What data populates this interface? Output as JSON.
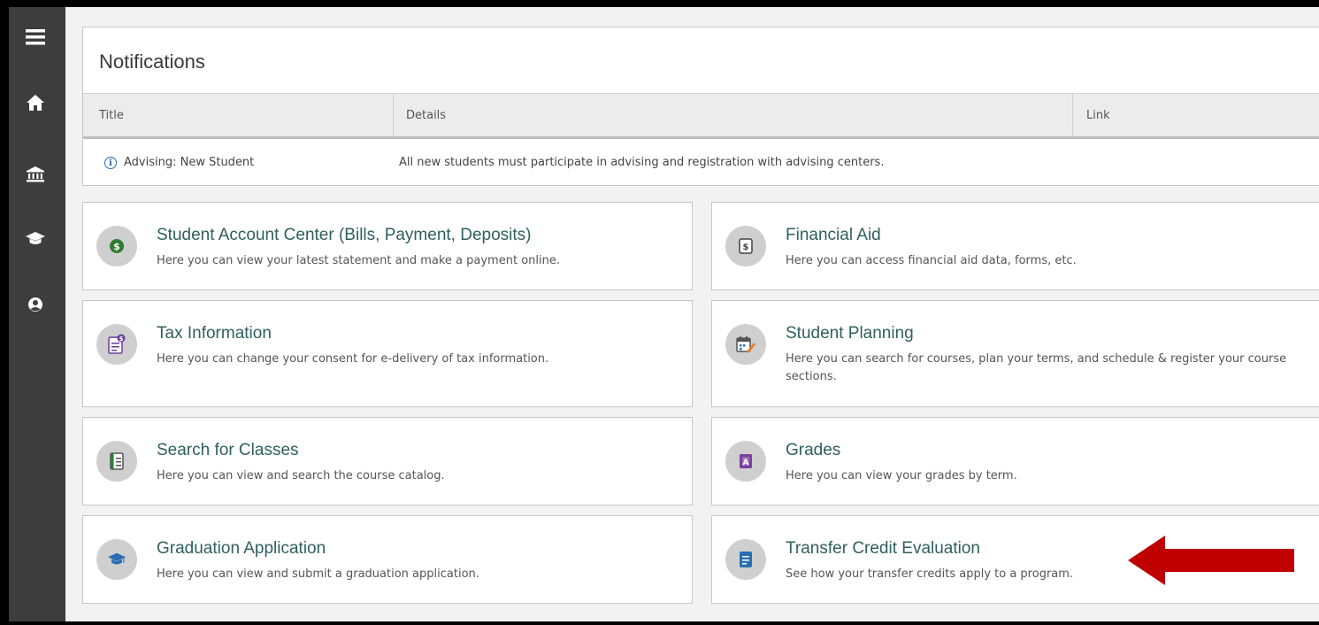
{
  "notifications": {
    "heading": "Notifications",
    "columns": [
      "Title",
      "Details",
      "Link"
    ],
    "rows": [
      {
        "title": "Advising: New Student",
        "details": "All new students must participate in advising and registration with advising centers.",
        "link": ""
      }
    ]
  },
  "sidebar": {
    "items": [
      {
        "icon": "menu-icon"
      },
      {
        "icon": "home-icon"
      },
      {
        "icon": "bank-icon"
      },
      {
        "icon": "graduation-cap-icon"
      },
      {
        "icon": "user-circle-icon"
      }
    ]
  },
  "tiles": [
    {
      "title": "Student Account Center (Bills, Payment, Deposits)",
      "desc": "Here you can view your latest statement and make a payment online.",
      "icon": "dollar-icon",
      "icon_color": "#2e7d32"
    },
    {
      "title": "Financial Aid",
      "desc": "Here you can access financial aid data, forms, etc.",
      "icon": "money-icon",
      "icon_color": "#444444"
    },
    {
      "title": "Tax Information",
      "desc": "Here you can change your consent for e-delivery of tax information.",
      "icon": "tax-document-icon",
      "icon_color": "#6a3d9a"
    },
    {
      "title": "Student Planning",
      "desc": "Here you can search for courses, plan your terms, and schedule & register your course sections.",
      "icon": "calendar-icon",
      "icon_color": "#e67e22"
    },
    {
      "title": "Search for Classes",
      "desc": "Here you can view and search the course catalog.",
      "icon": "catalog-icon",
      "icon_color": "#2e7d32"
    },
    {
      "title": "Grades",
      "desc": "Here you can view your grades by term.",
      "icon": "grades-icon",
      "icon_color": "#7b3fa0"
    },
    {
      "title": "Graduation Application",
      "desc": "Here you can view and submit a graduation application.",
      "icon": "graduation-cap-icon",
      "icon_color": "#2a6fb5"
    },
    {
      "title": "Transfer Credit Evaluation",
      "desc": "See how your transfer credits apply to a program.",
      "icon": "transfer-credit-icon",
      "icon_color": "#2a6fb5"
    }
  ],
  "colors": {
    "sidebar": "#3d3d3d",
    "tile_title": "#2f5f5f",
    "arrow": "#c00000",
    "info": "#2a6fb5"
  }
}
